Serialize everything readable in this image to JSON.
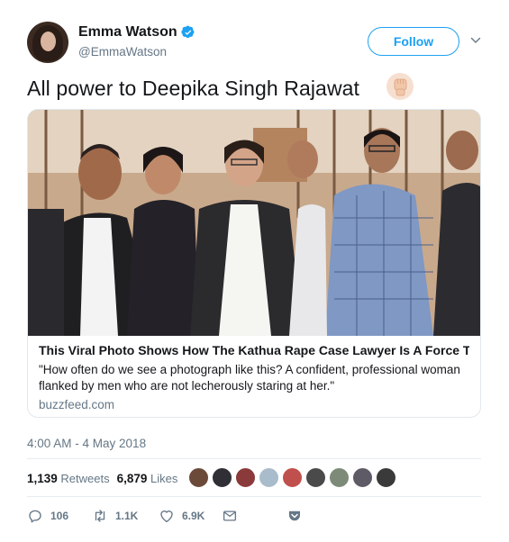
{
  "author": {
    "display_name": "Emma Watson",
    "handle": "@EmmaWatson",
    "verified": true,
    "avatar_icon": "avatar-photo"
  },
  "follow_button": {
    "label": "Follow"
  },
  "menu_icon": "chevron-down-icon",
  "tweet": {
    "text": "All power to Deepika Singh Rajawat",
    "emoji_icon": "raised-fist-icon"
  },
  "card": {
    "title": "This Viral Photo Shows How The Kathua Rape Case Lawyer Is A Force To Re...",
    "description": "\"How often do we see a photograph like this? A confident, professional woman flanked by men who are not lecherously staring at her.\"",
    "domain": "buzzfeed.com"
  },
  "timestamp": "4:00 AM - 4 May 2018",
  "stats": {
    "retweets_count": "1,139",
    "retweets_label": "Retweets",
    "likes_count": "6,879",
    "likes_label": "Likes",
    "liker_avatar_count": 9
  },
  "actions": {
    "reply_count": "106",
    "retweet_count": "1.1K",
    "like_count": "6.9K"
  },
  "colors": {
    "accent": "#1da1f2",
    "muted": "#657786",
    "text": "#14171a",
    "border": "#e1e8ed"
  }
}
